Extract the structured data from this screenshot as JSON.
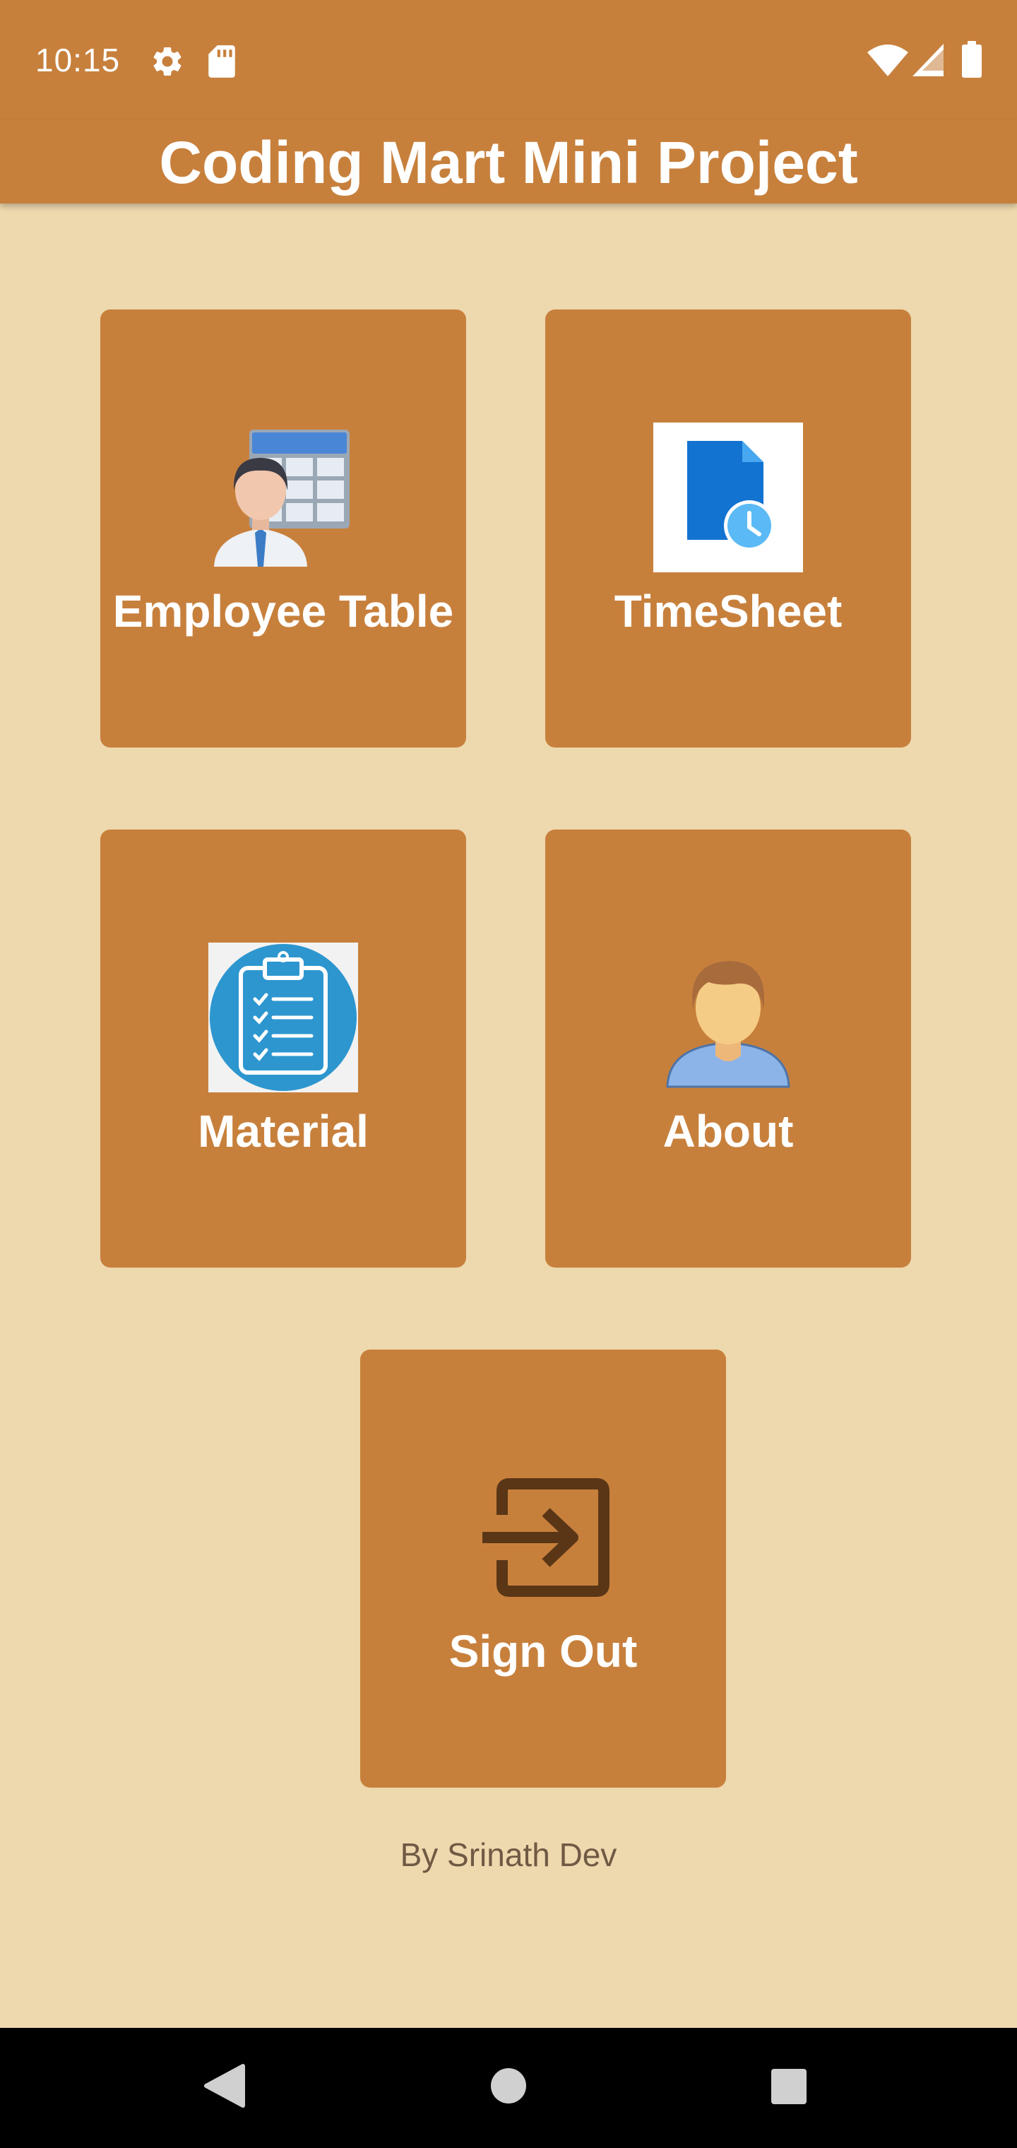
{
  "status_bar": {
    "time": "10:15",
    "left_icons": [
      "gear-icon",
      "sd-card-icon"
    ],
    "right_icons": [
      "wifi-icon",
      "cell-signal-icon",
      "battery-icon"
    ]
  },
  "app_bar": {
    "title": "Coding Mart Mini Project"
  },
  "tiles": [
    {
      "label": "Employee Table",
      "icon": "employee-table-icon"
    },
    {
      "label": "TimeSheet",
      "icon": "timesheet-icon"
    },
    {
      "label": "Material",
      "icon": "clipboard-checklist-icon"
    },
    {
      "label": "About",
      "icon": "person-avatar-icon"
    },
    {
      "label": "Sign Out",
      "icon": "sign-out-icon"
    }
  ],
  "footer": {
    "credit": "By Srinath Dev"
  },
  "nav_bar": {
    "buttons": [
      "back-icon",
      "home-icon",
      "recents-icon"
    ]
  },
  "colors": {
    "background": "#EED8AE",
    "app_bar": "#C7803C",
    "tile": "#C7803C",
    "tile_text": "#FFFFFF",
    "footer_text": "#6E5A44",
    "nav_bar": "#000000"
  }
}
